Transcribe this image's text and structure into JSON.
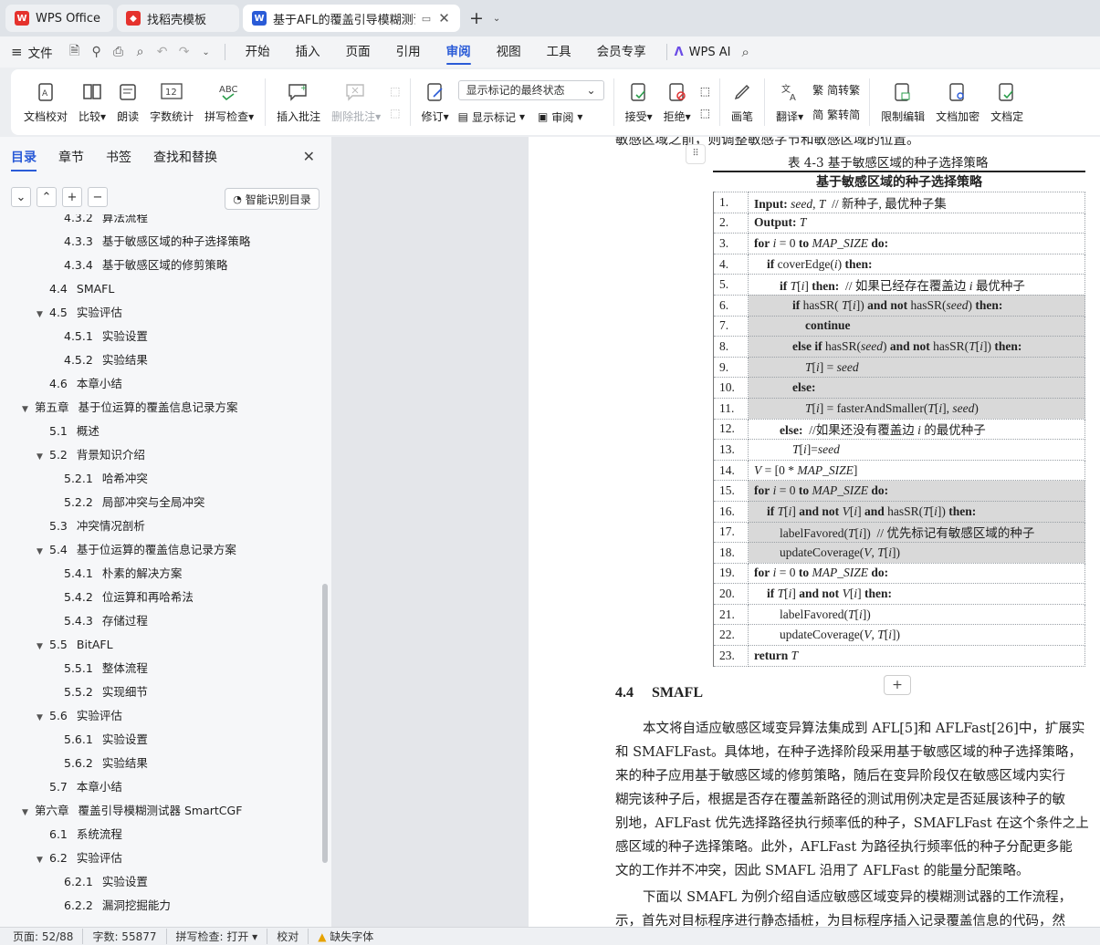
{
  "tabs": [
    {
      "label": "WPS Office",
      "icon": "wps-logo-icon",
      "color": "#e5322d"
    },
    {
      "label": "找稻壳模板",
      "icon": "docer-logo-icon",
      "color": "#e5322d"
    },
    {
      "label": "基于AFL的覆盖引导模糊测试优",
      "icon": "writer-logo-icon",
      "color": "#2a5bd7"
    }
  ],
  "menu": {
    "file": "文件",
    "items": [
      "开始",
      "插入",
      "页面",
      "引用",
      "审阅",
      "视图",
      "工具",
      "会员专享"
    ],
    "active": "审阅",
    "wps_ai": "WPS AI"
  },
  "ribbon": {
    "proofread": "文档校对",
    "compare": "比较",
    "read_aloud": "朗读",
    "word_count": "字数统计",
    "spell_check": "拼写检查",
    "insert_comment": "插入批注",
    "delete_comment": "删除批注",
    "revise": "修订",
    "display_mode": "显示标记的最终状态",
    "show_markup": "显示标记",
    "review": "审阅",
    "accept": "接受",
    "reject": "拒绝",
    "pen": "画笔",
    "translate": "翻译",
    "to_traditional": "简转繁",
    "to_simplified": "繁转简",
    "restrict_edit": "限制编辑",
    "encrypt": "文档加密",
    "finalize": "文档定"
  },
  "sidebar": {
    "tabs": [
      "目录",
      "章节",
      "书签",
      "查找和替换"
    ],
    "active_tab": "目录",
    "smart_toc": "智能识别目录",
    "toc": [
      {
        "num": "4.3.2",
        "text": "算法流程",
        "level": 3,
        "arrow": false
      },
      {
        "num": "4.3.3",
        "text": "基于敏感区域的种子选择策略",
        "level": 3,
        "arrow": false
      },
      {
        "num": "4.3.4",
        "text": "基于敏感区域的修剪策略",
        "level": 3,
        "arrow": false
      },
      {
        "num": "4.4",
        "text": "SMAFL",
        "level": 2,
        "arrow": false
      },
      {
        "num": "4.5",
        "text": "实验评估",
        "level": 2,
        "arrow": true
      },
      {
        "num": "4.5.1",
        "text": "实验设置",
        "level": 3,
        "arrow": false
      },
      {
        "num": "4.5.2",
        "text": "实验结果",
        "level": 3,
        "arrow": false
      },
      {
        "num": "4.6",
        "text": "本章小结",
        "level": 2,
        "arrow": false
      },
      {
        "num": "第五章",
        "text": "基于位运算的覆盖信息记录方案",
        "level": 1,
        "arrow": true
      },
      {
        "num": "5.1",
        "text": "概述",
        "level": 2,
        "arrow": false
      },
      {
        "num": "5.2",
        "text": "背景知识介绍",
        "level": 2,
        "arrow": true
      },
      {
        "num": "5.2.1",
        "text": "哈希冲突",
        "level": 3,
        "arrow": false
      },
      {
        "num": "5.2.2",
        "text": "局部冲突与全局冲突",
        "level": 3,
        "arrow": false
      },
      {
        "num": "5.3",
        "text": "冲突情况剖析",
        "level": 2,
        "arrow": false
      },
      {
        "num": "5.4",
        "text": "基于位运算的覆盖信息记录方案",
        "level": 2,
        "arrow": true
      },
      {
        "num": "5.4.1",
        "text": "朴素的解决方案",
        "level": 3,
        "arrow": false
      },
      {
        "num": "5.4.2",
        "text": "位运算和再哈希法",
        "level": 3,
        "arrow": false
      },
      {
        "num": "5.4.3",
        "text": "存储过程",
        "level": 3,
        "arrow": false
      },
      {
        "num": "5.5",
        "text": "BitAFL",
        "level": 2,
        "arrow": true
      },
      {
        "num": "5.5.1",
        "text": "整体流程",
        "level": 3,
        "arrow": false
      },
      {
        "num": "5.5.2",
        "text": "实现细节",
        "level": 3,
        "arrow": false
      },
      {
        "num": "5.6",
        "text": "实验评估",
        "level": 2,
        "arrow": true
      },
      {
        "num": "5.6.1",
        "text": "实验设置",
        "level": 3,
        "arrow": false
      },
      {
        "num": "5.6.2",
        "text": "实验结果",
        "level": 3,
        "arrow": false
      },
      {
        "num": "5.7",
        "text": "本章小结",
        "level": 2,
        "arrow": false
      },
      {
        "num": "第六章",
        "text": "覆盖引导模糊测试器 SmartCGF",
        "level": 1,
        "arrow": true
      },
      {
        "num": "6.1",
        "text": "系统流程",
        "level": 2,
        "arrow": false
      },
      {
        "num": "6.2",
        "text": "实验评估",
        "level": 2,
        "arrow": true
      },
      {
        "num": "6.2.1",
        "text": "实验设置",
        "level": 3,
        "arrow": false
      },
      {
        "num": "6.2.2",
        "text": "漏洞挖掘能力",
        "level": 3,
        "arrow": false
      }
    ]
  },
  "document": {
    "top_line": "敏感区域之前，则调整敏感字节和敏感区域的位置。",
    "table_caption": "表 4-3   基于敏感区域的种子选择策略",
    "table_title": "基于敏感区域的种子选择策略",
    "algo_lines": [
      {
        "n": "1.",
        "html": "<b>Input:</b> <i>seed</i>, <i>T</i>  &nbsp;// 新种子, 最优种子集",
        "indent": 0,
        "hl": false
      },
      {
        "n": "2.",
        "html": "<b>Output:</b> <i>T</i>",
        "indent": 0,
        "hl": false
      },
      {
        "n": "3.",
        "html": "<b>for</b> <i>i</i> = 0 <b>to</b> <i>MAP_SIZE</i> <b>do:</b>",
        "indent": 0,
        "hl": false
      },
      {
        "n": "4.",
        "html": "<b>if</b> coverEdge(<i>i</i>) <b>then:</b>",
        "indent": 1,
        "hl": false
      },
      {
        "n": "5.",
        "html": "<b>if</b> <i>T</i>[<i>i</i>] <b>then:</b>  &nbsp;// 如果已经存在覆盖边 <i>i</i> 最优种子",
        "indent": 2,
        "hl": false
      },
      {
        "n": "6.",
        "html": "<b>if</b> hasSR( <i>T</i>[<i>i</i>]) <b>and not</b> hasSR(<i>seed</i>) <b>then:</b>",
        "indent": 3,
        "hl": true
      },
      {
        "n": "7.",
        "html": "<b>continue</b>",
        "indent": 4,
        "hl": true
      },
      {
        "n": "8.",
        "html": "<b>else if</b> hasSR(<i>seed</i>) <b>and not</b> hasSR(<i>T</i>[<i>i</i>]) <b>then:</b>",
        "indent": 3,
        "hl": true
      },
      {
        "n": "9.",
        "html": "<i>T</i>[<i>i</i>] = <i>seed</i>",
        "indent": 4,
        "hl": true
      },
      {
        "n": "10.",
        "html": "<b>else:</b>",
        "indent": 3,
        "hl": true
      },
      {
        "n": "11.",
        "html": "<i>T</i>[<i>i</i>] = fasterAndSmaller(<i>T</i>[<i>i</i>], <i>seed</i>)",
        "indent": 4,
        "hl": true
      },
      {
        "n": "12.",
        "html": "<b>else:</b>  &nbsp;//如果还没有覆盖边 <i>i</i> 的最优种子",
        "indent": 2,
        "hl": false
      },
      {
        "n": "13.",
        "html": "<i>T</i>[<i>i</i>]=<i>seed</i>",
        "indent": 3,
        "hl": false
      },
      {
        "n": "14.",
        "html": "<i>V</i> = [0 * <i>MAP_SIZE</i>]",
        "indent": 0,
        "hl": false
      },
      {
        "n": "15.",
        "html": "<b>for</b> <i>i</i> = 0 <b>to</b> <i>MAP_SIZE</i> <b>do:</b>",
        "indent": 0,
        "hl": true
      },
      {
        "n": "16.",
        "html": "<b>if</b> <i>T</i>[<i>i</i>] <b>and not</b> <i>V</i>[<i>i</i>] <b>and</b> hasSR(<i>T</i>[<i>i</i>]) <b>then:</b>",
        "indent": 1,
        "hl": true
      },
      {
        "n": "17.",
        "html": "labelFavored(<i>T</i>[<i>i</i>])  &nbsp;// 优先标记有敏感区域的种子",
        "indent": 2,
        "hl": true
      },
      {
        "n": "18.",
        "html": "updateCoverage(<i>V</i>, <i>T</i>[<i>i</i>])",
        "indent": 2,
        "hl": true
      },
      {
        "n": "19.",
        "html": "<b>for</b> <i>i</i> = 0 <b>to</b> <i>MAP_SIZE</i> <b>do:</b>",
        "indent": 0,
        "hl": false
      },
      {
        "n": "20.",
        "html": "<b>if</b> <i>T</i>[<i>i</i>] <b>and not</b> <i>V</i>[<i>i</i>] <b>then:</b>",
        "indent": 1,
        "hl": false
      },
      {
        "n": "21.",
        "html": "labelFavored(<i>T</i>[<i>i</i>])",
        "indent": 2,
        "hl": false
      },
      {
        "n": "22.",
        "html": "updateCoverage(<i>V</i>, <i>T</i>[<i>i</i>])",
        "indent": 2,
        "hl": false
      },
      {
        "n": "23.",
        "html": "<b>return</b> <i>T</i>",
        "indent": 0,
        "hl": false
      }
    ],
    "section_number": "4.4",
    "section_title": "SMAFL",
    "paragraphs": [
      "本文将自适应敏感区域变异算法集成到 AFL[5]和 AFLFast[26]中，扩展实",
      "和 SMAFLFast。具体地，在种子选择阶段采用基于敏感区域的种子选择策略，",
      "来的种子应用基于敏感区域的修剪策略，随后在变异阶段仅在敏感区域内实行",
      "糊完该种子后，根据是否存在覆盖新路径的测试用例决定是否延展该种子的敏",
      "别地，AFLFast 优先选择路径执行频率低的种子，SMAFLFast 在这个条件之上",
      "感区域的种子选择策略。此外，AFLFast 为路径执行频率低的种子分配更多能",
      "文的工作并不冲突，因此 SMAFL 沿用了 AFLFast 的能量分配策略。",
      "下面以 SMAFL 为例介绍自适应敏感区域变异的模糊测试器的工作流程，",
      "示，首先对目标程序进行静态插桩，为目标程序插入记录覆盖信息的代码，然"
    ]
  },
  "status": {
    "page": "页面: 52/88",
    "words": "字数: 55877",
    "spell": "拼写检查: 打开",
    "proof": "校对",
    "missing_font": "缺失字体"
  }
}
